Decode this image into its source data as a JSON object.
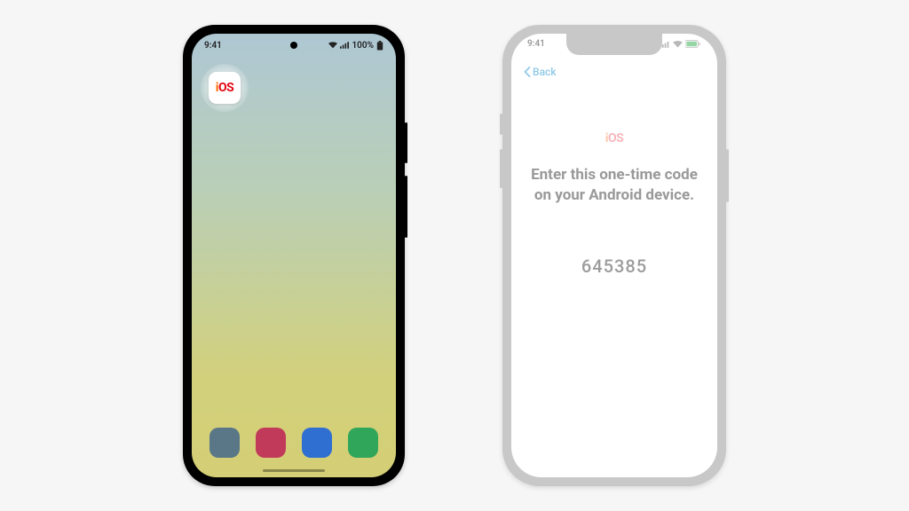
{
  "android": {
    "status_time": "9:41",
    "status_battery_text": "100%",
    "ios_app_label_prefix": "i",
    "ios_app_label_suffix": "OS"
  },
  "iphone": {
    "status_time": "9:41",
    "back_label": "Back",
    "logo_prefix": "i",
    "logo_suffix": "OS",
    "instruction": "Enter this one-time code on your Android device.",
    "code": "645385"
  }
}
